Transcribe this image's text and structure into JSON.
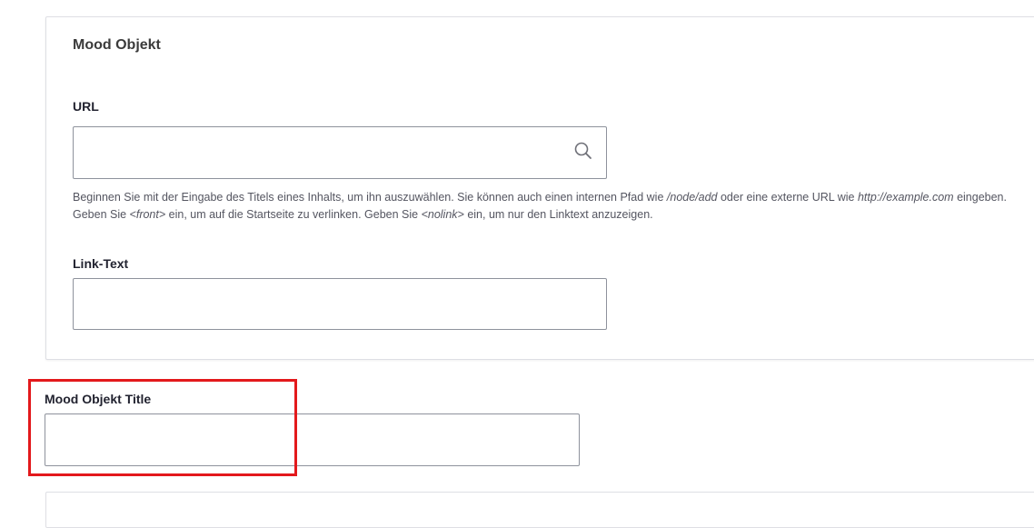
{
  "mood_objekt": {
    "legend": "Mood Objekt",
    "url": {
      "label": "URL",
      "value": "",
      "placeholder": "",
      "icon": "search-icon",
      "description": {
        "part1": "Beginnen Sie mit der Eingabe des Titels eines Inhalts, um ihn auszuwählen. Sie können auch einen internen Pfad wie ",
        "example_path": "/node/add",
        "part2": " oder eine externe URL wie ",
        "example_url": "http://example.com",
        "part3": " eingeben. Geben Sie ",
        "front_token": "<front>",
        "part4": " ein, um auf die Startseite zu verlinken. Geben Sie ",
        "nolink_token": "<nolink>",
        "part5": " ein, um nur den Linktext anzuzeigen."
      }
    },
    "link_text": {
      "label": "Link-Text",
      "value": "",
      "placeholder": ""
    }
  },
  "mood_objekt_title": {
    "label": "Mood Objekt Title",
    "value": "",
    "placeholder": ""
  },
  "colors": {
    "highlight": "#e3191c",
    "border": "#8e929c",
    "fieldset_border": "#dedfe4"
  }
}
